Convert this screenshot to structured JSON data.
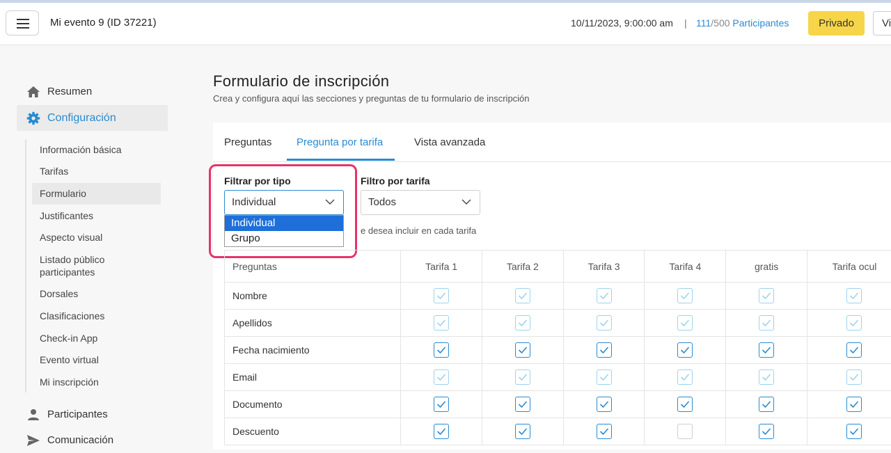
{
  "header": {
    "event_title": "Mi evento 9 (ID 37221)",
    "datetime": "10/11/2023, 9:00:00 am",
    "separator": "|",
    "participants_current": "111",
    "participants_max": "/500",
    "participants_label": "Participantes",
    "privado_label": "Privado",
    "v_label": "Vi"
  },
  "sidebar": {
    "top": [
      {
        "label": "Resumen",
        "icon": "home-icon"
      },
      {
        "label": "Configuración",
        "icon": "gear-icon",
        "active": true
      }
    ],
    "sub": [
      {
        "label": "Información básica"
      },
      {
        "label": "Tarifas"
      },
      {
        "label": "Formulario",
        "active": true
      },
      {
        "label": "Justificantes"
      },
      {
        "label": "Aspecto visual"
      },
      {
        "label": "Listado público participantes"
      },
      {
        "label": "Dorsales"
      },
      {
        "label": "Clasificaciones"
      },
      {
        "label": "Check-in App"
      },
      {
        "label": "Evento virtual"
      },
      {
        "label": "Mi inscripción"
      }
    ],
    "bottom": [
      {
        "label": "Participantes",
        "icon": "user-icon"
      },
      {
        "label": "Comunicación",
        "icon": "send-icon"
      }
    ]
  },
  "main": {
    "title": "Formulario de inscripción",
    "subtitle": "Crea y configura aquí las secciones y preguntas de tu formulario de inscripción",
    "tabs": [
      {
        "label": "Preguntas"
      },
      {
        "label": "Pregunta por tarifa",
        "active": true
      },
      {
        "label": "Vista avanzada"
      }
    ],
    "filter_type": {
      "label": "Filtrar por tipo",
      "value": "Individual",
      "options": [
        "Individual",
        "Grupo"
      ]
    },
    "filter_tarifa": {
      "label": "Filtro por tarifa",
      "value": "Todos"
    },
    "hint": "e desea incluir en cada tarifa",
    "table": {
      "headers": [
        "Preguntas",
        "Tarifa 1",
        "Tarifa 2",
        "Tarifa 3",
        "Tarifa 4",
        "gratis",
        "Tarifa ocul"
      ],
      "rows": [
        {
          "q": "Nombre",
          "cells": [
            "light",
            "light",
            "light",
            "light",
            "light",
            "light"
          ]
        },
        {
          "q": "Apellidos",
          "cells": [
            "light",
            "light",
            "light",
            "light",
            "light",
            "light"
          ]
        },
        {
          "q": "Fecha nacimiento",
          "cells": [
            "checked",
            "checked",
            "checked",
            "checked",
            "checked",
            "checked"
          ]
        },
        {
          "q": "Email",
          "cells": [
            "light",
            "light",
            "light",
            "light",
            "light",
            "light"
          ]
        },
        {
          "q": "Documento",
          "cells": [
            "checked",
            "checked",
            "checked",
            "checked",
            "checked",
            "checked"
          ]
        },
        {
          "q": "Descuento",
          "cells": [
            "checked",
            "checked",
            "checked",
            "unchecked",
            "checked",
            "checked"
          ]
        }
      ]
    }
  },
  "colors": {
    "accent": "#2a8bd0",
    "privado": "#f7d54a",
    "highlight": "#e6336b",
    "dropdown_selected": "#1e6fd9"
  }
}
